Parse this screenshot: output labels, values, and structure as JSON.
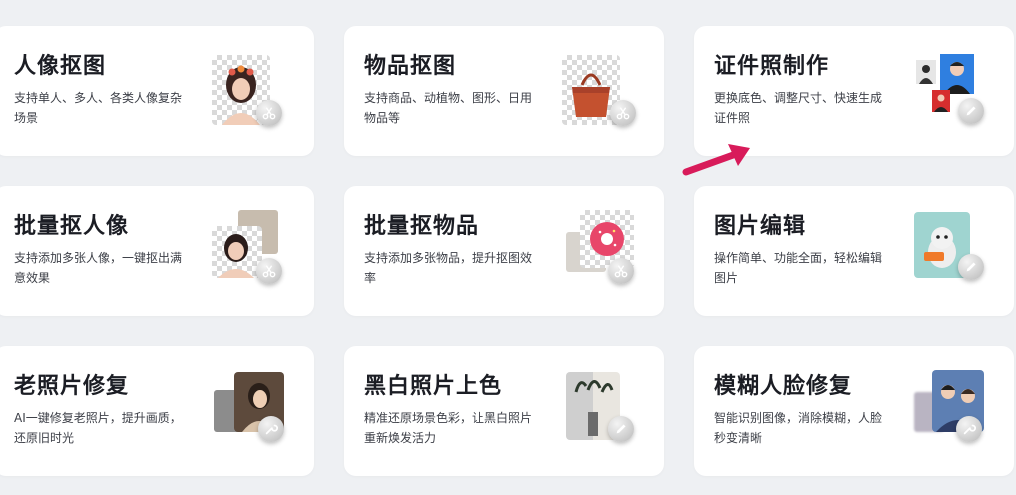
{
  "cards": [
    {
      "title": "人像抠图",
      "desc": "支持单人、多人、各类人像复杂场景",
      "icon": "scissors-icon"
    },
    {
      "title": "物品抠图",
      "desc": "支持商品、动植物、图形、日用物品等",
      "icon": "scissors-icon"
    },
    {
      "title": "证件照制作",
      "desc": "更换底色、调整尺寸、快速生成证件照",
      "icon": "pencil-icon"
    },
    {
      "title": "批量抠人像",
      "desc": "支持添加多张人像，一键抠出满意效果",
      "icon": "scissors-icon"
    },
    {
      "title": "批量抠物品",
      "desc": "支持添加多张物品，提升抠图效率",
      "icon": "scissors-icon"
    },
    {
      "title": "图片编辑",
      "desc": "操作简单、功能全面，轻松编辑图片",
      "icon": "pencil-icon"
    },
    {
      "title": "老照片修复",
      "desc": "AI一键修复老照片，提升画质，还原旧时光",
      "icon": "wrench-icon"
    },
    {
      "title": "黑白照片上色",
      "desc": "精准还原场景色彩，让黑白照片重新焕发活力",
      "icon": "pencil-icon"
    },
    {
      "title": "模糊人脸修复",
      "desc": "智能识别图像，消除模糊，人脸秒变清晰",
      "icon": "wrench-icon"
    }
  ],
  "colors": {
    "background": "#eef0f3",
    "card": "#ffffff",
    "title": "#1b1d24",
    "desc": "#3c3f47",
    "arrow": "#d81b5a"
  }
}
